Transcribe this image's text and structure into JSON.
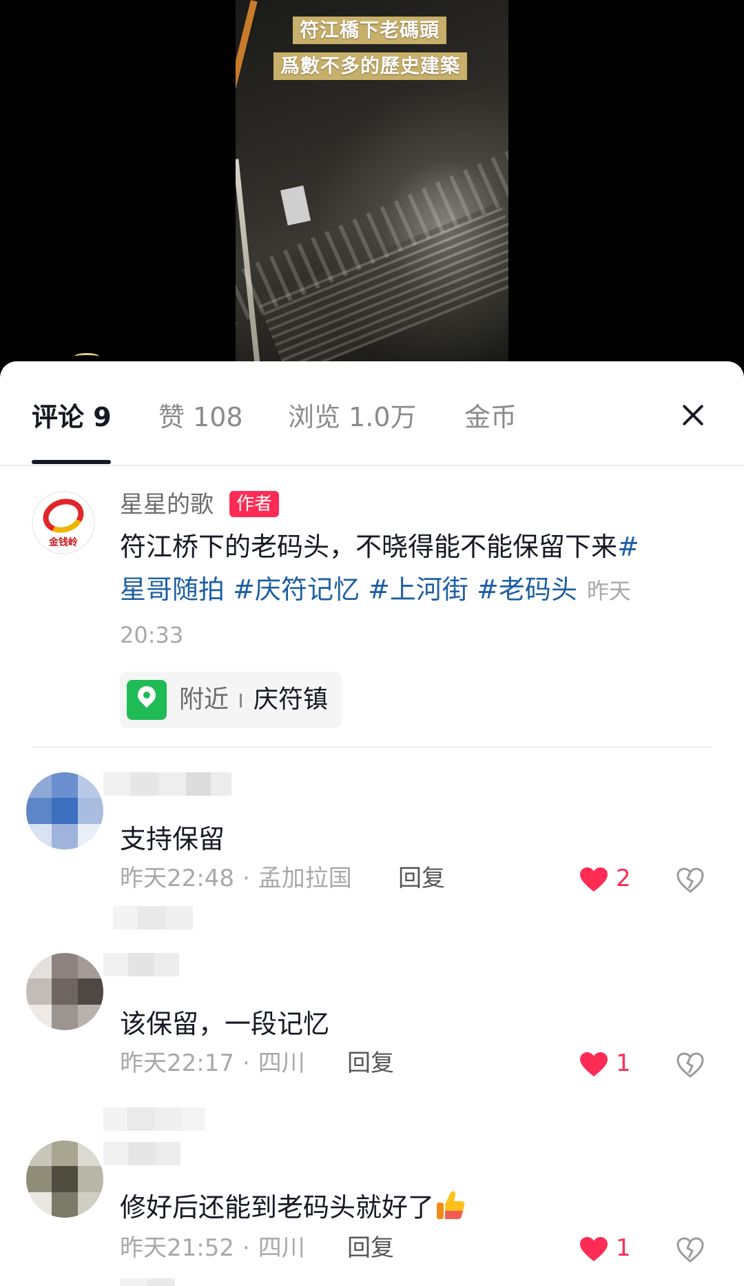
{
  "video": {
    "caption_line1": "符江橋下老碼頭",
    "caption_line2": "爲數不多的歷史建築"
  },
  "tabs": [
    {
      "label": "评论 9",
      "active": true
    },
    {
      "label": "赞 108",
      "active": false
    },
    {
      "label": "浏览 1.0万",
      "active": false
    },
    {
      "label": "金币",
      "active": false
    }
  ],
  "author_comment": {
    "avatar_text": "金钱岭",
    "user": "星星的歌",
    "badge": "作者",
    "text_plain": "符江桥下的老码头，不晓得能不能保留下来",
    "hashtags": [
      "#星哥随拍",
      "#庆符记忆",
      "#上河街",
      "#老码头"
    ],
    "time": "昨天20:33",
    "location_prefix": "附近",
    "location_place": "庆符镇"
  },
  "comments": [
    {
      "text": "支持保留",
      "time": "昨天22:48",
      "region": "孟加拉国",
      "reply": "回复",
      "likes": "2"
    },
    {
      "text": "该保留，一段记忆",
      "time": "昨天22:17",
      "region": "四川",
      "reply": "回复",
      "likes": "1"
    },
    {
      "text": "修好后还能到老码头就好了",
      "time": "昨天21:52",
      "region": "四川",
      "reply": "回复",
      "likes": "1",
      "emoji": "thumbs-up"
    }
  ],
  "colors": {
    "accent": "#fe2c55",
    "hashtag": "#1d5fa3",
    "location": "#1fbb55"
  }
}
